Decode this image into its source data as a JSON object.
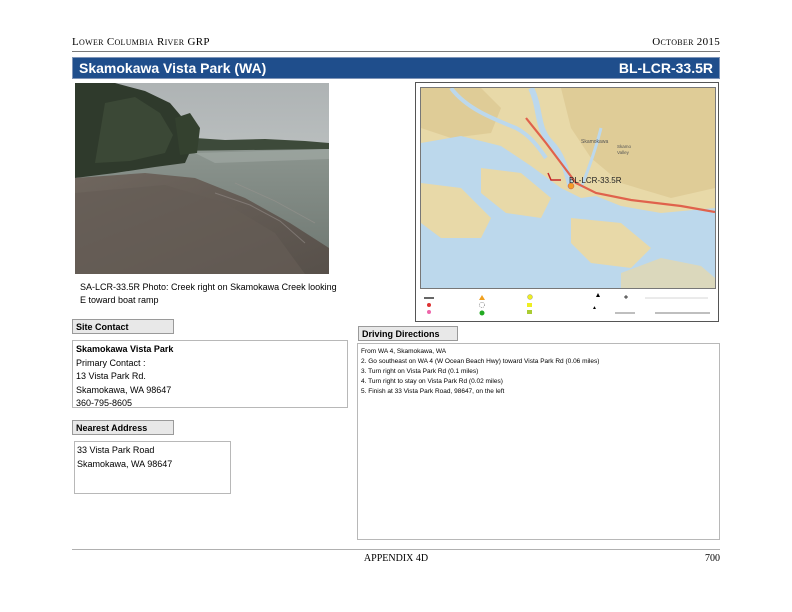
{
  "header": {
    "left": "Lower Columbia River GRP",
    "right": "October 2015"
  },
  "title_bar": {
    "site_name": "Skamokawa Vista Park (WA)",
    "site_id": "BL-LCR-33.5R"
  },
  "photo": {
    "caption_line1": "SA-LCR-33.5R Photo: Creek right on Skamokawa Creek looking",
    "caption_line2": "E toward boat ramp"
  },
  "map": {
    "site_label": "BL-LCR-33.5R",
    "colors": {
      "water": "#bcd8ec",
      "land": "#e8d9a8",
      "road": "#e0624c",
      "marker": "#c62828"
    }
  },
  "site_contact": {
    "heading": "Site Contact",
    "lines": [
      "Skamokawa Vista Park",
      "Primary Contact :",
      "13 Vista Park Rd.",
      "Skamokawa, WA 98647",
      "360-795-8605"
    ]
  },
  "nearest_address": {
    "heading": "Nearest Address",
    "lines": [
      "33 Vista Park Road",
      "Skamokawa, WA 98647"
    ]
  },
  "driving_directions": {
    "heading": "Driving Directions",
    "lines": [
      "From WA 4, Skamokawa, WA",
      "2. Go southeast on WA 4 (W Ocean Beach Hwy) toward Vista Park Rd (0.06 miles)",
      "3. Turn right on Vista Park Rd (0.1 miles)",
      "4. Turn right to stay on Vista Park Rd (0.02 miles)",
      "5. Finish at 33 Vista Park Road, 98647, on the left"
    ]
  },
  "footer": {
    "center": "APPENDIX 4D",
    "page": "700"
  }
}
